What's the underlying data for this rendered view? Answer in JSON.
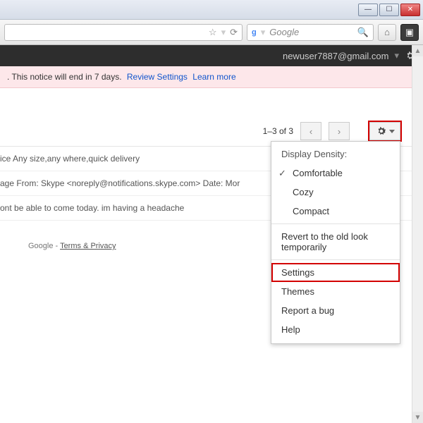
{
  "browser": {
    "search_placeholder": "Google",
    "star": "☆",
    "reload": "⟳",
    "search": "🔍",
    "home": "⌂",
    "ext": "▣"
  },
  "header": {
    "user_email": "newuser7887@gmail.com"
  },
  "notice": {
    "text": ". This notice will end in 7 days.",
    "link1": "Review Settings",
    "link2": "Learn more"
  },
  "toolbar": {
    "count": "1–3 of 3"
  },
  "rows": {
    "r1": "ice Any size,any where,quick delivery",
    "r2": "age From: Skype <noreply@notifications.skype.com> Date: Mor",
    "r3": "ont be able to come today. im having a headache"
  },
  "footer": {
    "google": "Google",
    "terms": "Terms & Privacy"
  },
  "menu": {
    "header": "Display Density:",
    "comfortable": "Comfortable",
    "cozy": "Cozy",
    "compact": "Compact",
    "revert": "Revert to the old look temporarily",
    "settings": "Settings",
    "themes": "Themes",
    "report": "Report a bug",
    "help": "Help"
  }
}
